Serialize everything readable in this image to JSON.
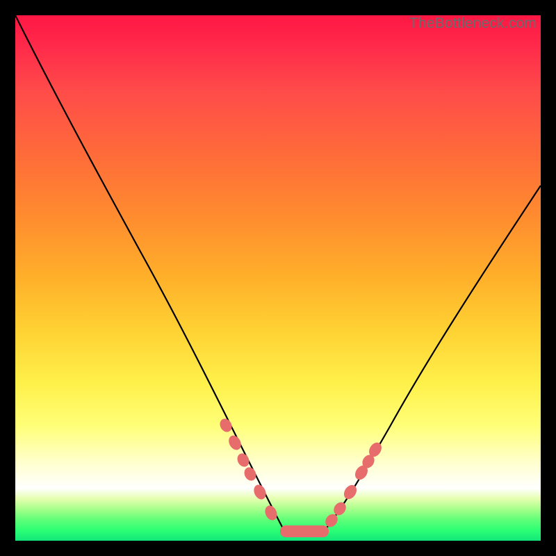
{
  "watermark": "TheBottleneck.com",
  "colors": {
    "frame": "#000000",
    "curve": "#000000",
    "bead": "#e76d6d",
    "gradient_stops": [
      "#ff1744",
      "#ff6a3a",
      "#ffb02a",
      "#fff04a",
      "#ffffff",
      "#2cff74"
    ]
  },
  "chart_data": {
    "type": "line",
    "title": "",
    "xlabel": "",
    "ylabel": "",
    "xlim": [
      0,
      100
    ],
    "ylim": [
      0,
      100
    ],
    "note": "Axes are unlabeled; x/y are normalized 0-100 within the plot area. y=0 is bottom, y=100 is top.",
    "series": [
      {
        "name": "left-branch",
        "x": [
          0,
          4,
          8,
          12,
          16,
          20,
          24,
          28,
          32,
          36,
          40,
          42,
          44,
          46,
          48,
          50,
          51
        ],
        "y": [
          100,
          92,
          83,
          75,
          67,
          59,
          51,
          43,
          36,
          29,
          22,
          18,
          14,
          11,
          8,
          4,
          2
        ]
      },
      {
        "name": "valley-floor",
        "x": [
          51,
          53,
          55,
          57,
          59
        ],
        "y": [
          2,
          2,
          2,
          2,
          2
        ]
      },
      {
        "name": "right-branch",
        "x": [
          59,
          61,
          63,
          66,
          70,
          75,
          80,
          85,
          90,
          95,
          100
        ],
        "y": [
          2,
          5,
          9,
          14,
          21,
          30,
          39,
          48,
          56,
          63,
          68
        ]
      }
    ],
    "markers": [
      {
        "name": "left-cluster",
        "points": [
          {
            "x": 40,
            "y": 22
          },
          {
            "x": 42,
            "y": 18
          },
          {
            "x": 44,
            "y": 15
          },
          {
            "x": 45,
            "y": 12
          },
          {
            "x": 47,
            "y": 9
          },
          {
            "x": 49,
            "y": 5
          }
        ]
      },
      {
        "name": "bottom-pill",
        "points": [
          {
            "x": 51,
            "y": 2
          },
          {
            "x": 59,
            "y": 2
          }
        ]
      },
      {
        "name": "right-cluster",
        "points": [
          {
            "x": 60,
            "y": 4
          },
          {
            "x": 62,
            "y": 7
          },
          {
            "x": 64,
            "y": 11
          },
          {
            "x": 66,
            "y": 15
          },
          {
            "x": 67,
            "y": 17
          },
          {
            "x": 68,
            "y": 19
          }
        ]
      }
    ]
  }
}
